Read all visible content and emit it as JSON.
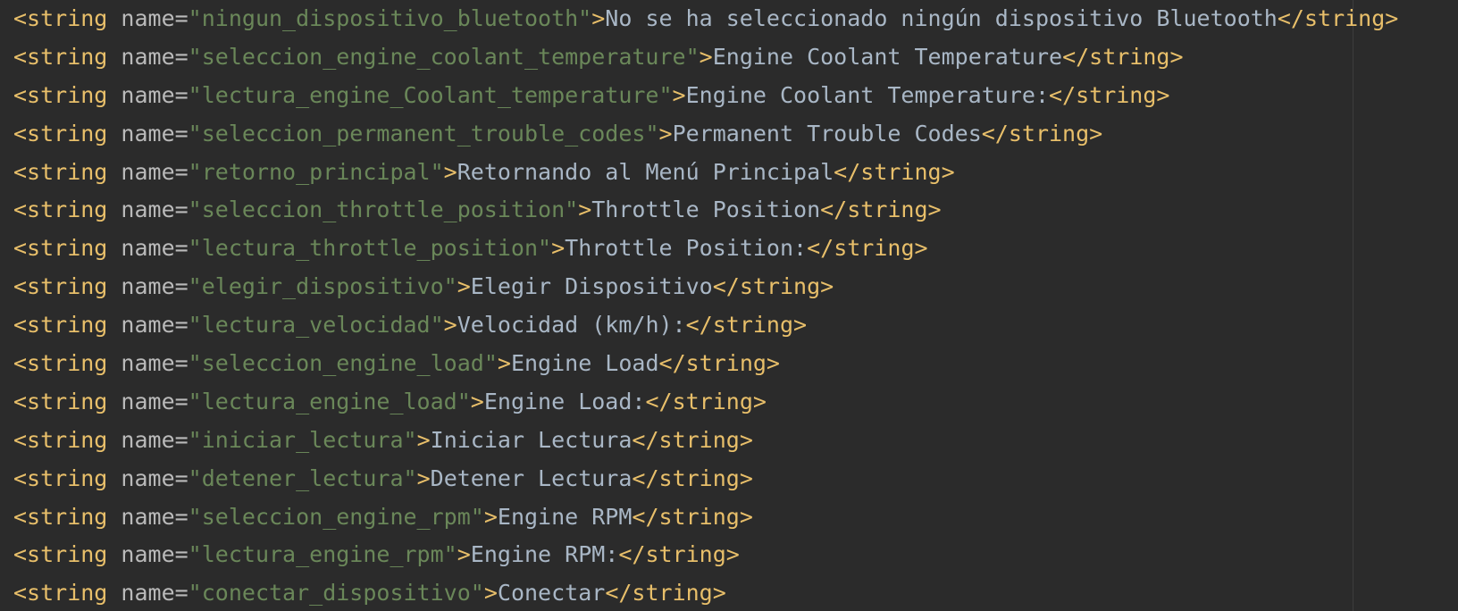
{
  "editor": {
    "lines": [
      {
        "name": "ningun_dispositivo_bluetooth",
        "text": "No se ha seleccionado ningún dispositivo Bluetooth"
      },
      {
        "name": "seleccion_engine_coolant_temperature",
        "text": "Engine Coolant Temperature"
      },
      {
        "name": "lectura_engine_Coolant_temperature",
        "text": "Engine Coolant Temperature:"
      },
      {
        "name": "seleccion_permanent_trouble_codes",
        "text": "Permanent Trouble Codes"
      },
      {
        "name": "retorno_principal",
        "text": "Retornando al Menú Principal"
      },
      {
        "name": "seleccion_throttle_position",
        "text": "Throttle Position"
      },
      {
        "name": "lectura_throttle_position",
        "text": "Throttle Position:"
      },
      {
        "name": "elegir_dispositivo",
        "text": "Elegir Dispositivo"
      },
      {
        "name": "lectura_velocidad",
        "text": "Velocidad (km/h):"
      },
      {
        "name": "seleccion_engine_load",
        "text": "Engine Load"
      },
      {
        "name": "lectura_engine_load",
        "text": "Engine Load:"
      },
      {
        "name": "iniciar_lectura",
        "text": "Iniciar Lectura"
      },
      {
        "name": "detener_lectura",
        "text": "Detener Lectura"
      },
      {
        "name": "seleccion_engine_rpm",
        "text": "Engine RPM"
      },
      {
        "name": "lectura_engine_rpm",
        "text": "Engine RPM:"
      },
      {
        "name": "conectar_dispositivo",
        "text": "Conectar"
      }
    ]
  },
  "syntax": {
    "open_tag": "<string",
    "attr_name": " name=",
    "tag_close": ">",
    "close_tag": "</string>"
  },
  "colors": {
    "background": "#2b2b2b",
    "tag": "#e8bf6a",
    "attribute": "#bababa",
    "string_value": "#6a8759",
    "text": "#a9b7c6"
  }
}
